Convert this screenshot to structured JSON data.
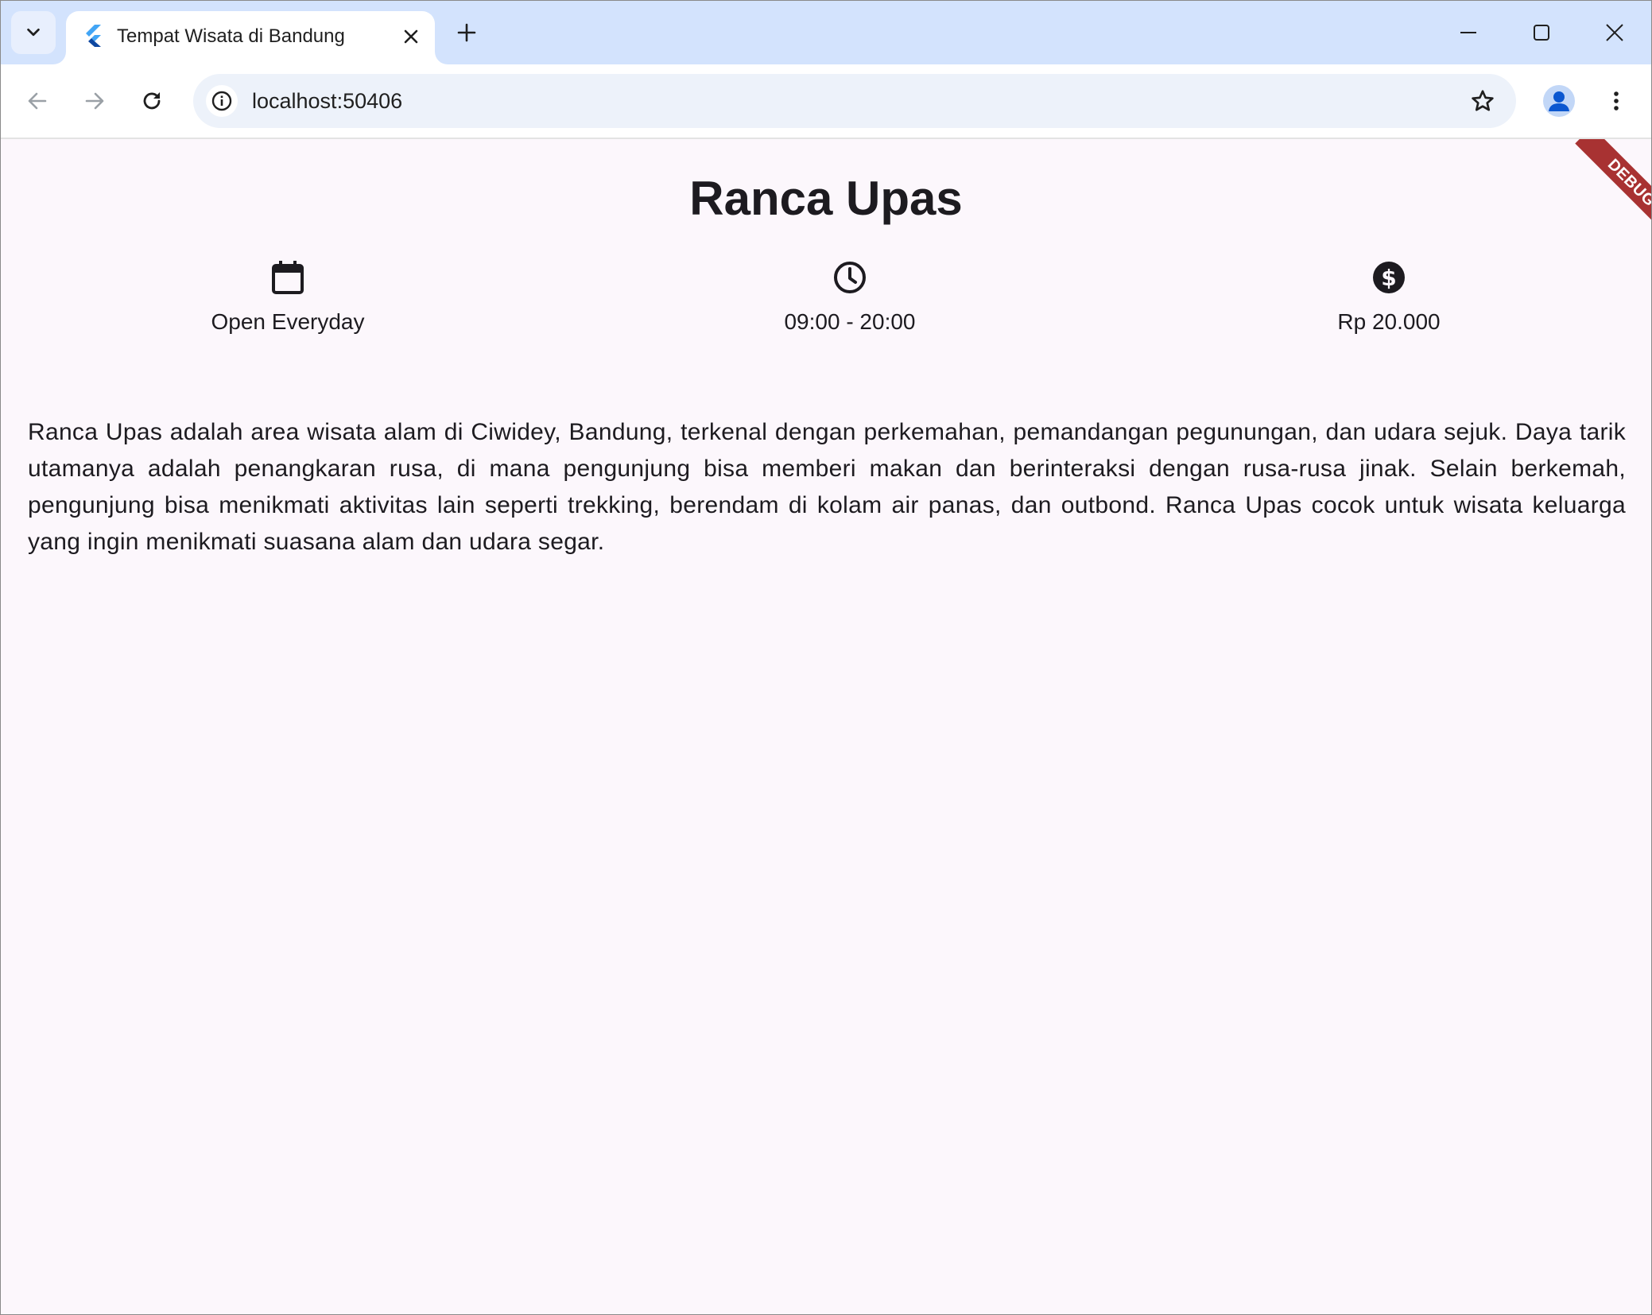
{
  "browser": {
    "tab": {
      "title": "Tempat Wisata di Bandung",
      "favicon": "flutter-logo-icon"
    },
    "toolbar": {
      "url": "localhost:50406"
    },
    "icons": {
      "tab_search": "chevron-down-icon",
      "tab_close": "close-icon",
      "new_tab": "plus-icon",
      "minimize": "minimize-icon",
      "maximize": "maximize-icon",
      "close_window": "close-icon",
      "back": "arrow-left-icon",
      "forward": "arrow-right-icon",
      "reload": "reload-icon",
      "site_info": "info-icon",
      "bookmark": "star-outline-icon",
      "profile": "person-icon",
      "menu": "more-vert-icon"
    }
  },
  "page": {
    "title": "Ranca Upas",
    "info": [
      {
        "icon": "calendar-icon",
        "label": "Open Everyday"
      },
      {
        "icon": "clock-icon",
        "label": "09:00 - 20:00"
      },
      {
        "icon": "dollar-circle-icon",
        "label": "Rp 20.000"
      }
    ],
    "description": "Ranca Upas adalah area wisata alam di Ciwidey, Bandung, terkenal dengan perkemahan, pemandangan pegunungan, dan udara sejuk. Daya tarik utamanya adalah penangkaran rusa, di mana pengunjung bisa memberi makan dan berinteraksi dengan rusa-rusa jinak. Selain berkemah, pengunjung bisa menikmati aktivitas lain seperti trekking, berendam di kolam air panas, dan outbond. Ranca Upas cocok untuk wisata keluarga yang ingin menikmati suasana alam dan udara segar.",
    "debug_banner": "DEBUG"
  },
  "colors": {
    "tabstrip_bg": "#d3e3fd",
    "page_bg": "#fcf7fc",
    "text": "#1d1b20",
    "debug_banner": "#a83232",
    "flutter_blue": "#42a5f5"
  }
}
